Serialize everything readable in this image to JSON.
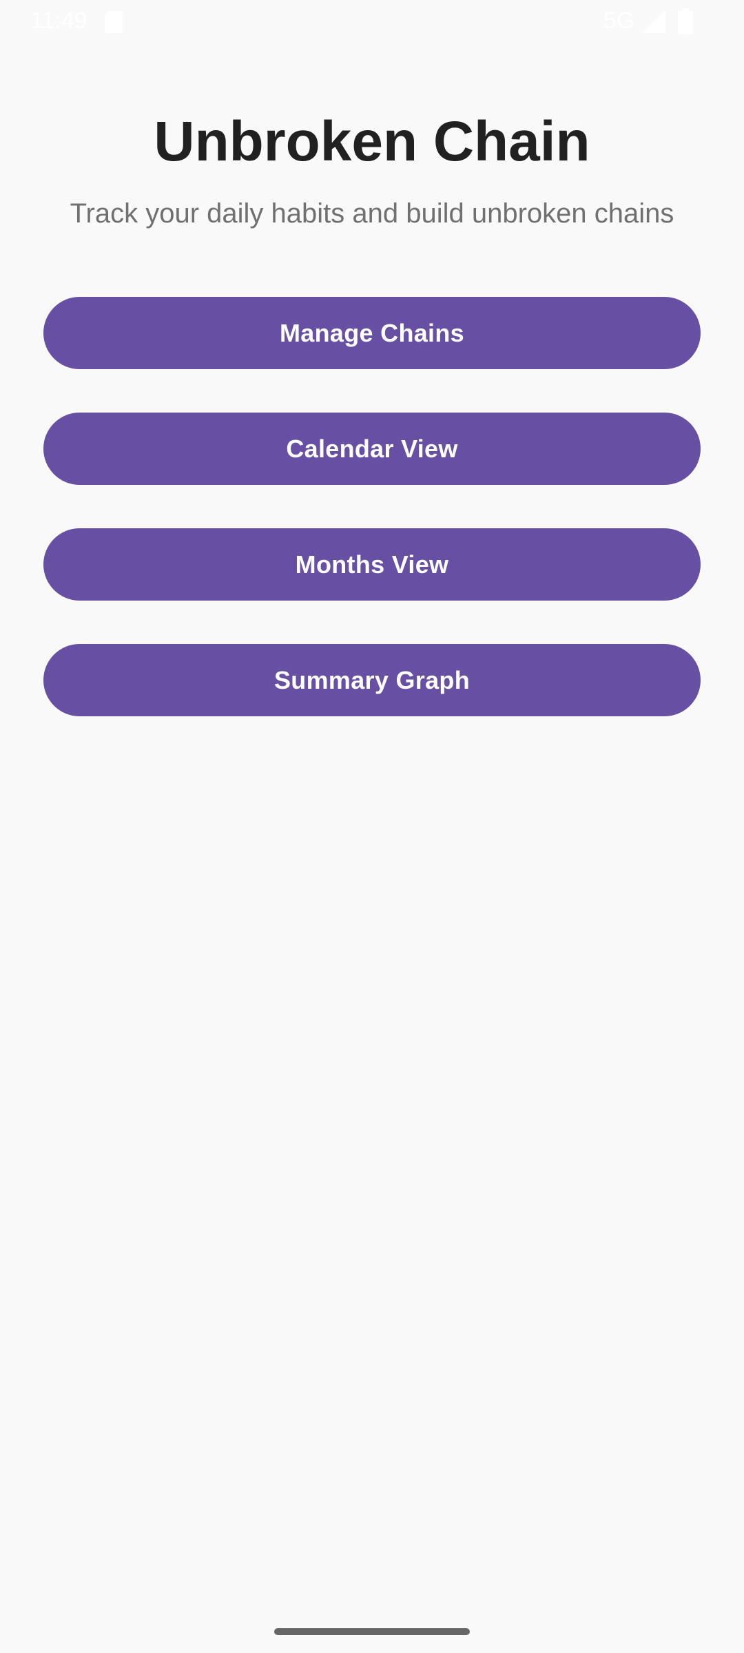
{
  "status_bar": {
    "time": "11:49",
    "network": "5G",
    "icons": [
      "sim-card-icon",
      "signal-icon",
      "battery-icon"
    ]
  },
  "header": {
    "title": "Unbroken Chain",
    "subtitle": "Track your daily habits and build unbroken chains"
  },
  "menu": {
    "buttons": [
      {
        "label": "Manage Chains"
      },
      {
        "label": "Calendar View"
      },
      {
        "label": "Months View"
      },
      {
        "label": "Summary Graph"
      }
    ]
  },
  "colors": {
    "background": "#f9f9f9",
    "button": "#6750a4",
    "button_text": "#ffffff",
    "title": "#212121",
    "subtitle": "#707070"
  }
}
